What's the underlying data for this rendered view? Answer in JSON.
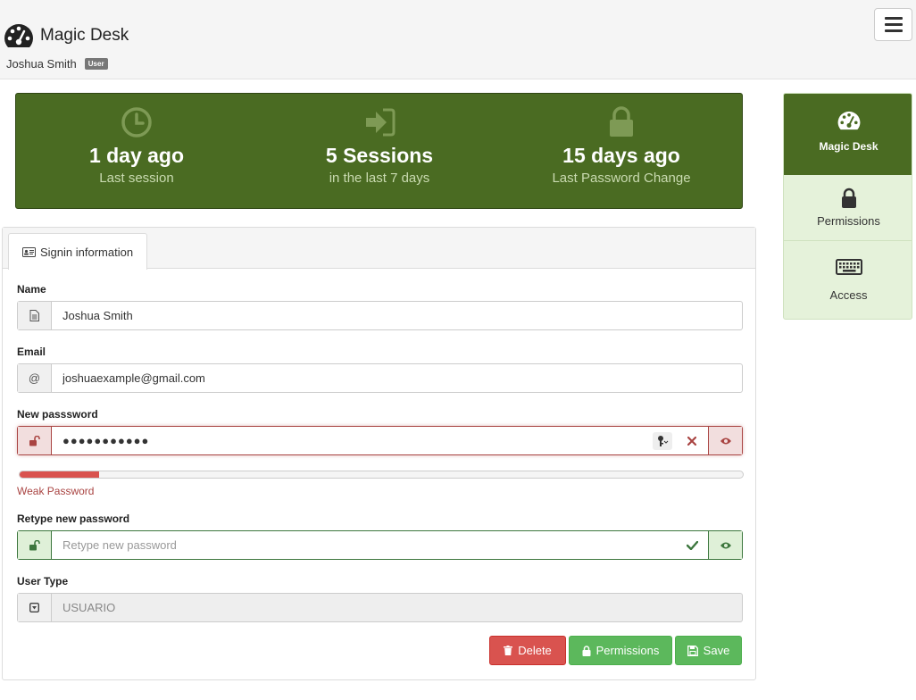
{
  "header": {
    "app_name": "Magic Desk",
    "user_name": "Joshua Smith",
    "user_badge": "User"
  },
  "stats": [
    {
      "icon": "clock-icon",
      "value": "1 day ago",
      "label": "Last session"
    },
    {
      "icon": "sign-in-icon",
      "value": "5 Sessions",
      "label": "in the last 7 days"
    },
    {
      "icon": "lock-icon",
      "value": "15 days ago",
      "label": "Last Password Change"
    }
  ],
  "sidenav": {
    "items": [
      {
        "label": "Magic Desk",
        "icon": "dashboard-icon",
        "active": true
      },
      {
        "label": "Permissions",
        "icon": "lock-icon",
        "active": false
      },
      {
        "label": "Access",
        "icon": "keyboard-icon",
        "active": false
      }
    ]
  },
  "tab": {
    "label": "Signin information",
    "icon": "id-card-icon"
  },
  "form": {
    "name": {
      "label": "Name",
      "value": "Joshua Smith"
    },
    "email": {
      "label": "Email",
      "value": "joshuaexample@gmail.com"
    },
    "new_password": {
      "label": "New passsword",
      "value": "●●●●●●●●●●●"
    },
    "strength": {
      "text": "Weak Password",
      "percent": 11
    },
    "retype_password": {
      "label": "Retype new password",
      "placeholder": "Retype new password",
      "value": ""
    },
    "user_type": {
      "label": "User Type",
      "value": "USUARIO"
    }
  },
  "actions": {
    "delete": "Delete",
    "permissions": "Permissions",
    "save": "Save"
  },
  "colors": {
    "brand_green": "#4a6b22",
    "danger": "#d9534f",
    "success": "#5cb85c",
    "nav_bg": "#e5f2da"
  }
}
